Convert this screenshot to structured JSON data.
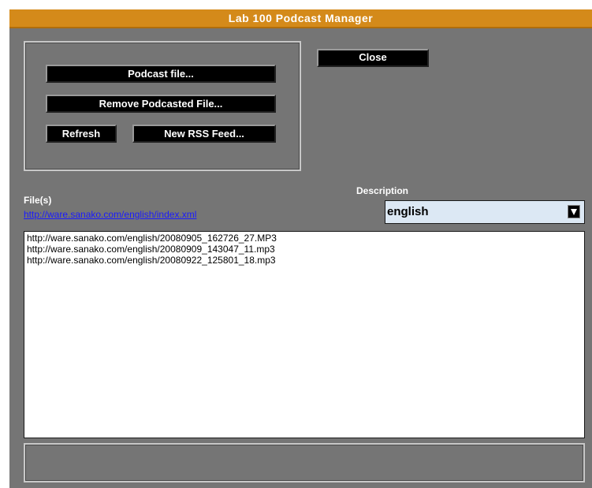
{
  "window": {
    "title": "Lab 100 Podcast Manager"
  },
  "buttons": {
    "podcast_file": "Podcast file...",
    "remove_podcasted_file": "Remove Podcasted File...",
    "refresh": "Refresh",
    "new_rss_feed": "New RSS Feed...",
    "close": "Close"
  },
  "files": {
    "label": "File(s)",
    "rss_link": "http://ware.sanako.com/english/index.xml",
    "items": [
      "http://ware.sanako.com/english/20080905_162726_27.MP3",
      "http://ware.sanako.com/english/20080909_143047_11.mp3",
      "http://ware.sanako.com/english/20080922_125801_18.mp3"
    ]
  },
  "description": {
    "label": "Description",
    "selected": "english"
  },
  "colors": {
    "title_bar": "#d48a1a",
    "panel": "#757575",
    "link": "#1a1aff",
    "select_bg": "#dce8f4"
  },
  "icons": {
    "dropdown": "chevron-down-icon"
  }
}
